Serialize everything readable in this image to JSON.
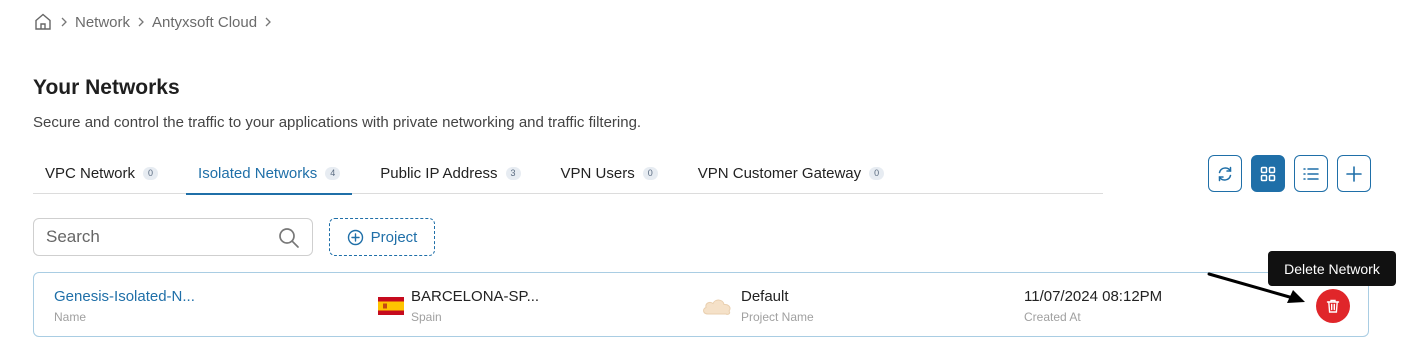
{
  "breadcrumb": {
    "items": [
      "Network",
      "Antyxsoft Cloud"
    ]
  },
  "page": {
    "title": "Your Networks",
    "description": "Secure and control the traffic to your applications with private networking and traffic filtering."
  },
  "tabs": [
    {
      "label": "VPC Network",
      "count": "0"
    },
    {
      "label": "Isolated Networks",
      "count": "4",
      "active": true
    },
    {
      "label": "Public IP Address",
      "count": "3"
    },
    {
      "label": "VPN Users",
      "count": "0"
    },
    {
      "label": "VPN Customer Gateway",
      "count": "0"
    }
  ],
  "toolbar": {
    "icons": [
      "refresh-icon",
      "grid-view-icon",
      "list-view-icon",
      "plus-icon"
    ],
    "active": "grid-view-icon"
  },
  "search": {
    "placeholder": "Search",
    "value": ""
  },
  "project_filter": {
    "label": "Project"
  },
  "network": {
    "name": "Genesis-Isolated-N...",
    "name_caption": "Name",
    "location": "BARCELONA-SP...",
    "country": "Spain",
    "project": "Default",
    "project_caption": "Project Name",
    "created": "11/07/2024 08:12PM",
    "created_caption": "Created At"
  },
  "tooltip": {
    "text": "Delete Network"
  },
  "colors": {
    "accent": "#1f6fa8",
    "danger": "#e0262a",
    "card_border": "#a9cde3"
  }
}
